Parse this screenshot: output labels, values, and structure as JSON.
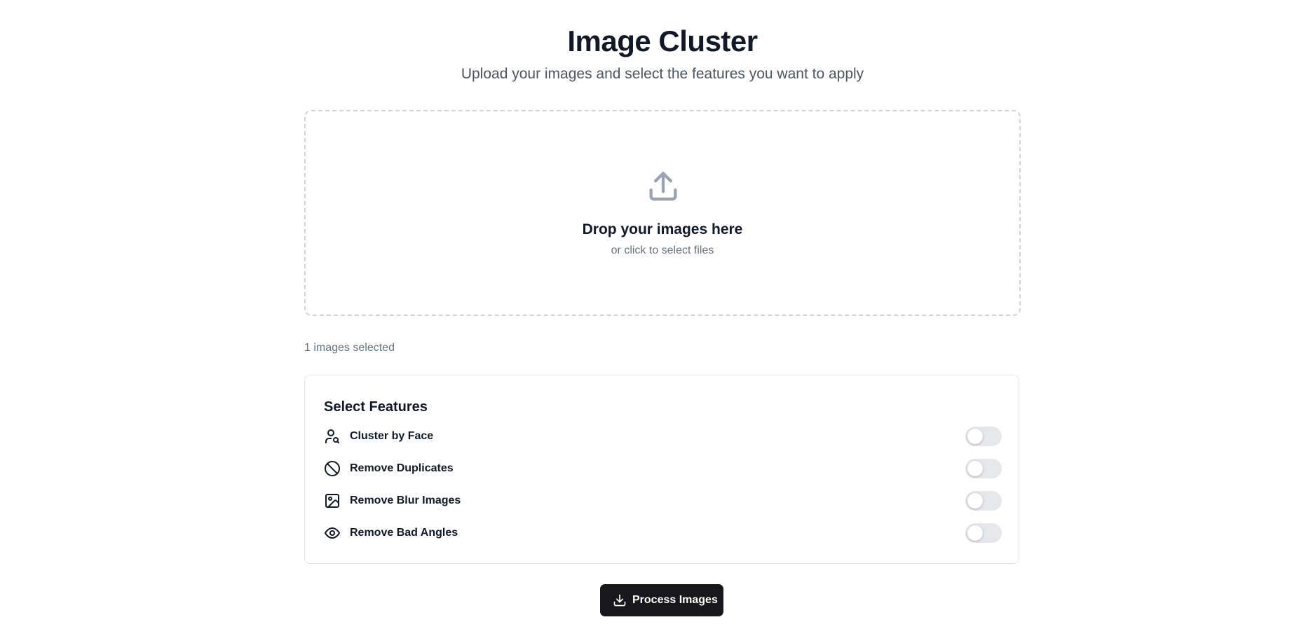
{
  "header": {
    "title": "Image Cluster",
    "subtitle": "Upload your images and select the features you want to apply"
  },
  "dropzone": {
    "icon": "upload-icon",
    "title": "Drop your images here",
    "subtitle": "or click to select files"
  },
  "selection": {
    "count_text": "1 images selected"
  },
  "features": {
    "heading": "Select Features",
    "items": [
      {
        "label": "Cluster by Face",
        "icon": "user-search-icon",
        "enabled": false
      },
      {
        "label": "Remove Duplicates",
        "icon": "ban-icon",
        "enabled": false
      },
      {
        "label": "Remove Blur Images",
        "icon": "image-icon",
        "enabled": false
      },
      {
        "label": "Remove Bad Angles",
        "icon": "eye-icon",
        "enabled": false
      }
    ]
  },
  "actions": {
    "process_label": "Process Images",
    "process_icon": "download-icon"
  },
  "colors": {
    "primary_button": "#18181b",
    "toggle_off": "#e5e7eb",
    "border": "#d1d5db",
    "muted_text": "#6b7280"
  }
}
